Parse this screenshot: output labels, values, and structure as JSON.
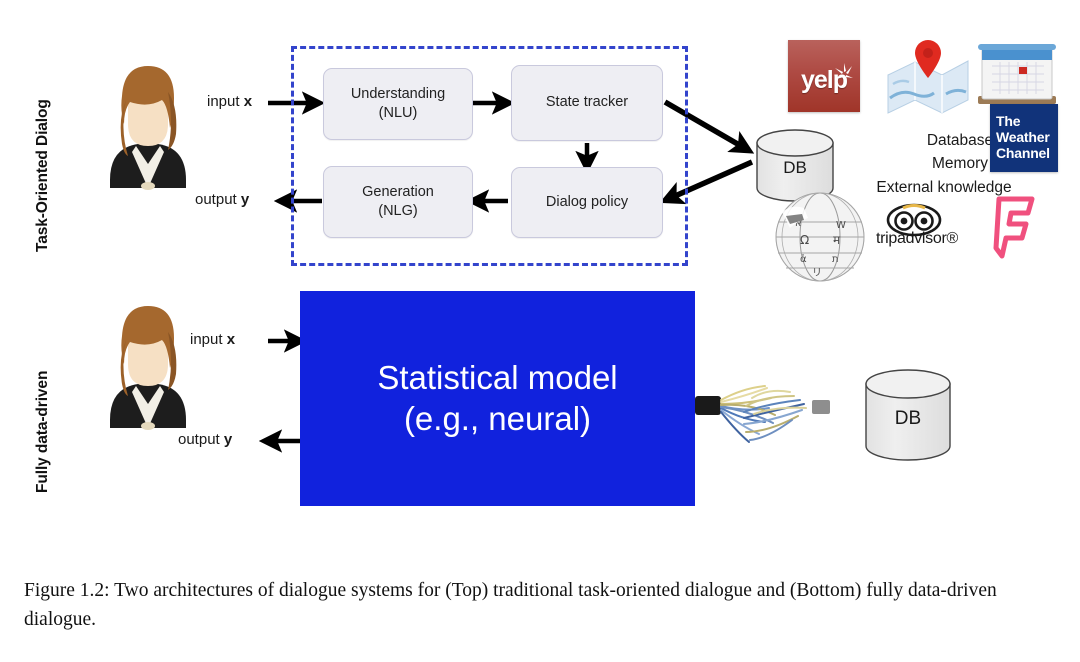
{
  "figure": {
    "caption": "Figure 1.2: Two architectures of dialogue systems for (Top) traditional task-oriented dialogue and (Bottom) fully data-driven dialogue."
  },
  "rows": {
    "top": {
      "label": "Task-Oriented Dialog",
      "avatar_name": "user-avatar",
      "input_label": "input ",
      "input_var": "x",
      "output_label": "output ",
      "output_var": "y",
      "boxes": [
        {
          "name": "nlu",
          "line1": "Understanding",
          "line2": "(NLU)"
        },
        {
          "name": "state-tracker",
          "line1": "State tracker",
          "line2": ""
        },
        {
          "name": "dialog-policy",
          "line1": "Dialog policy",
          "line2": ""
        },
        {
          "name": "nlg",
          "line1": "Generation",
          "line2": "(NLG)"
        }
      ],
      "db_label": "DB",
      "knowledge_lines": [
        "Database",
        "Memory",
        "External knowledge"
      ],
      "logos": [
        {
          "name": "yelp-logo",
          "text": "yelp"
        },
        {
          "name": "map-pin-logo",
          "text": ""
        },
        {
          "name": "calendar-logo",
          "text": ""
        },
        {
          "name": "weather-channel-logo",
          "text_lines": [
            "The",
            "Weather",
            "Channel"
          ]
        },
        {
          "name": "wikipedia-globe-logo",
          "text": ""
        },
        {
          "name": "tripadvisor-logo",
          "text": "tripadvisor®"
        },
        {
          "name": "foursquare-logo",
          "text": ""
        }
      ]
    },
    "bottom": {
      "label": "Fully data-driven",
      "avatar_name": "user-avatar",
      "input_label": "input ",
      "input_var": "x",
      "output_label": "output ",
      "output_var": "y",
      "model_line1": "Statistical model",
      "model_line2": "(e.g., neural)",
      "db_label": "DB"
    }
  },
  "colors": {
    "dashed_border": "#3344cc",
    "model_box": "#1122dd",
    "proc_box_fill": "#eeeef3",
    "db_fill": "#e9e9e9",
    "yelp_red": "#a03529",
    "weather_navy": "#11337a",
    "foursquare_pink": "#f0507e",
    "pin_red": "#e02a20"
  }
}
